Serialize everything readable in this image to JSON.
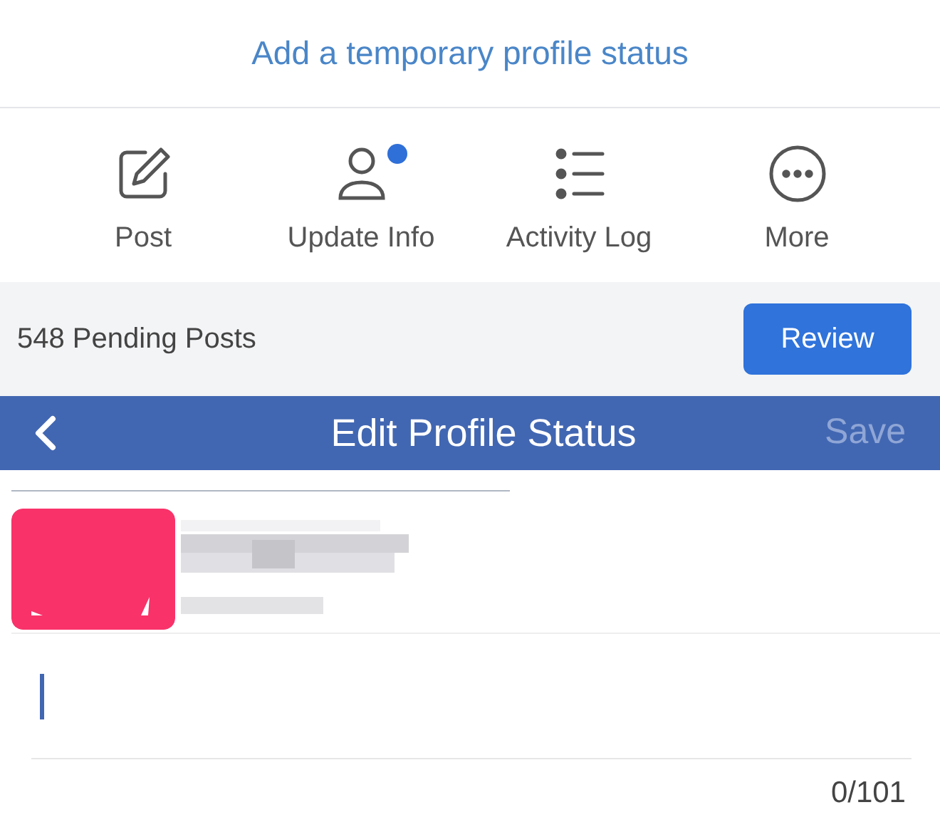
{
  "profile_link": "Add a temporary profile status",
  "actions": [
    {
      "label": "Post",
      "kind": "compose",
      "has_notification": false
    },
    {
      "label": "Update Info",
      "kind": "person",
      "has_notification": true
    },
    {
      "label": "Activity Log",
      "kind": "list",
      "has_notification": false
    },
    {
      "label": "More",
      "kind": "more",
      "has_notification": false
    }
  ],
  "pending": {
    "text": "548 Pending Posts",
    "button": "Review"
  },
  "header": {
    "title": "Edit Profile Status",
    "save": {
      "label": "Save",
      "disabled": true
    }
  },
  "composer": {
    "counter": "0/101"
  }
}
